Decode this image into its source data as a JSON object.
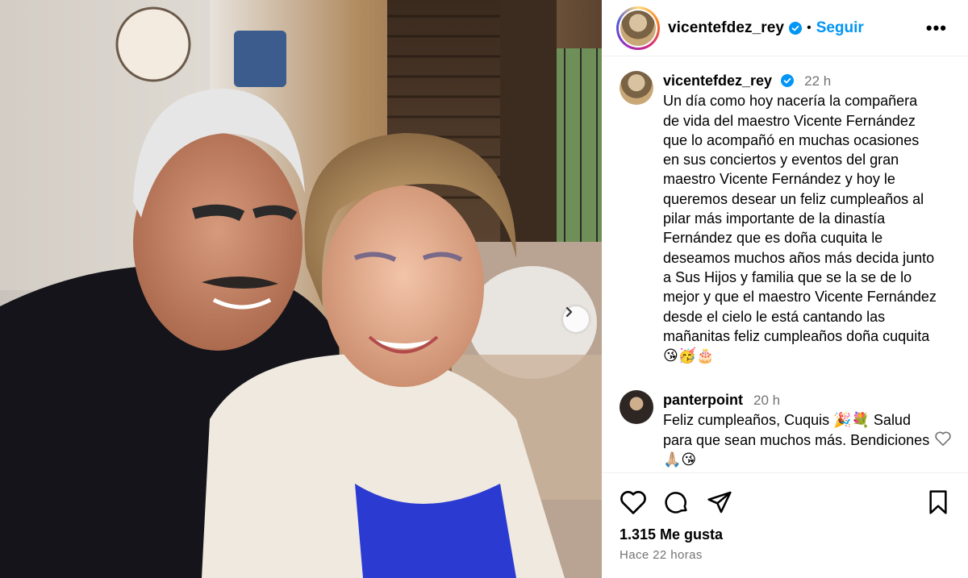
{
  "header": {
    "username": "vicentefdez_rey",
    "dot": "•",
    "follow_label": "Seguir",
    "more_label": "•••"
  },
  "caption": {
    "username": "vicentefdez_rey",
    "time": "22 h",
    "text": "Un día como hoy nacería la compañera de vida del maestro Vicente Fernández que lo acompañó en muchas ocasiones en sus conciertos y eventos del gran maestro Vicente Fernández y hoy le queremos desear un feliz cumpleaños al pilar más importante de la dinastía Fernández que es doña cuquita le deseamos muchos años más decida junto a Sus Hijos y familia que se la se de lo mejor y que el maestro Vicente Fernández desde el cielo le está cantando las mañanitas feliz cumpleaños doña cuquita 😘🥳🎂"
  },
  "comment": {
    "username": "panterpoint",
    "time": "20 h",
    "text": "Feliz cumpleaños, Cuquis 🎉💐 Salud para que sean muchos más. Bendiciones 🙏🏼😘"
  },
  "stats": {
    "likes": "1.315 Me gusta",
    "posted_ago": "Hace 22 horas"
  },
  "icons": {
    "verified": "verified-badge-icon",
    "next": "chevron-right-icon",
    "like": "heart-icon",
    "comment": "comment-bubble-icon",
    "share": "paper-plane-icon",
    "save": "bookmark-icon"
  },
  "colors": {
    "accent": "#0095f6",
    "muted": "#737373",
    "divider": "#efefef"
  }
}
